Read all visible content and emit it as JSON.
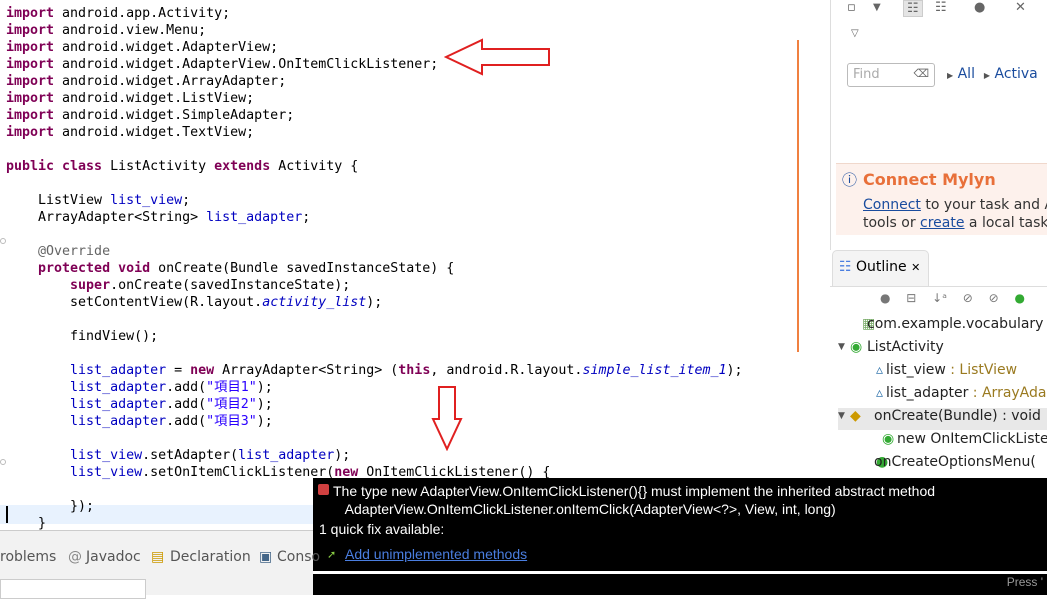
{
  "editor": {
    "lines": [
      [
        [
          "import ",
          "k"
        ],
        [
          "android.app.Activity;",
          ""
        ]
      ],
      [
        [
          "import ",
          "k"
        ],
        [
          "android.view.Menu;",
          ""
        ]
      ],
      [
        [
          "import ",
          "k"
        ],
        [
          "android.widget.AdapterView;",
          ""
        ]
      ],
      [
        [
          "import ",
          "k"
        ],
        [
          "android.widget.AdapterView.OnItemClickListener;",
          ""
        ]
      ],
      [
        [
          "import ",
          "k"
        ],
        [
          "android.widget.ArrayAdapter;",
          ""
        ]
      ],
      [
        [
          "import ",
          "k"
        ],
        [
          "android.widget.ListView;",
          ""
        ]
      ],
      [
        [
          "import ",
          "k"
        ],
        [
          "android.widget.SimpleAdapter;",
          ""
        ]
      ],
      [
        [
          "import ",
          "k"
        ],
        [
          "android.widget.TextView;",
          ""
        ]
      ],
      [],
      [
        [
          "public class ",
          "k"
        ],
        [
          "ListActivity ",
          ""
        ],
        [
          "extends ",
          "k"
        ],
        [
          "Activity {",
          ""
        ]
      ],
      [],
      [
        [
          "    ListView ",
          ""
        ],
        [
          "list_view",
          "f"
        ],
        [
          ";",
          ""
        ]
      ],
      [
        [
          "    ArrayAdapter<String> ",
          ""
        ],
        [
          "list_adapter",
          "f"
        ],
        [
          ";",
          ""
        ]
      ],
      [],
      [
        [
          "    @Override",
          "a"
        ]
      ],
      [
        [
          "    protected void ",
          "k"
        ],
        [
          "onCreate(Bundle savedInstanceState) {",
          ""
        ]
      ],
      [
        [
          "        super",
          "k"
        ],
        [
          ".onCreate(savedInstanceState);",
          ""
        ]
      ],
      [
        [
          "        setContentView(R.layout.",
          ""
        ],
        [
          "activity_list",
          "i"
        ],
        [
          ");",
          ""
        ]
      ],
      [],
      [
        [
          "        findView();",
          ""
        ]
      ],
      [],
      [
        [
          "        list_adapter",
          "f"
        ],
        [
          " = ",
          ""
        ],
        [
          "new ",
          "k"
        ],
        [
          "ArrayAdapter<String> (",
          ""
        ],
        [
          "this",
          "k"
        ],
        [
          ", android.R.layout.",
          ""
        ],
        [
          "simple_list_item_1",
          "i"
        ],
        [
          ");",
          ""
        ]
      ],
      [
        [
          "        list_adapter",
          "f"
        ],
        [
          ".add(",
          ""
        ],
        [
          "\"項目1\"",
          "s"
        ],
        [
          ");",
          ""
        ]
      ],
      [
        [
          "        list_adapter",
          "f"
        ],
        [
          ".add(",
          ""
        ],
        [
          "\"項目2\"",
          "s"
        ],
        [
          ");",
          ""
        ]
      ],
      [
        [
          "        list_adapter",
          "f"
        ],
        [
          ".add(",
          ""
        ],
        [
          "\"項目3\"",
          "s"
        ],
        [
          ");",
          ""
        ]
      ],
      [],
      [
        [
          "        list_view",
          "f"
        ],
        [
          ".setAdapter(",
          ""
        ],
        [
          "list_adapter",
          "f"
        ],
        [
          ");",
          ""
        ]
      ],
      [
        [
          "        list_view",
          "f"
        ],
        [
          ".setOnItemClickListener(",
          ""
        ],
        [
          "new ",
          "k"
        ],
        [
          "OnItemClickListener",
          "err"
        ],
        [
          "() {",
          ""
        ]
      ],
      [],
      [
        [
          "        });",
          ""
        ]
      ],
      [
        [
          "    }",
          ""
        ]
      ]
    ]
  },
  "right": {
    "find_placeholder": "Find",
    "filter_all": "All",
    "filter_activate": "Activa",
    "mylyn_title": "Connect Mylyn",
    "mylyn_connect": "Connect",
    "mylyn_text1": " to your task and AL",
    "mylyn_text2a": "tools or ",
    "mylyn_create": "create",
    "mylyn_text2b": " a local task."
  },
  "outline": {
    "tab": "Outline",
    "items": [
      {
        "name": "com.example.vocabulary",
        "type": ""
      },
      {
        "name": "ListActivity",
        "type": ""
      },
      {
        "name": "list_view",
        "type": " : ListView"
      },
      {
        "name": "list_adapter",
        "type": " : ArrayAdap"
      },
      {
        "name": "onCreate(Bundle) : void",
        "type": ""
      },
      {
        "name": "new OnItemClickLister",
        "type": ""
      },
      {
        "name": "onCreateOptionsMenu(",
        "type": ""
      }
    ]
  },
  "popup": {
    "message1": "The type new AdapterView.OnItemClickListener(){} must implement the inherited abstract method",
    "message2": "AdapterView.OnItemClickListener.onItemClick(AdapterView<?>, View, int, long)",
    "quickfix_count": "1 quick fix available:",
    "fix": "Add unimplemented methods",
    "press": "Press '"
  },
  "bottom": {
    "tabs": [
      "roblems",
      "Javadoc",
      "Declaration",
      "Conso"
    ]
  },
  "colors": {
    "arrow": "#e02020",
    "accent": "#e8703a"
  }
}
